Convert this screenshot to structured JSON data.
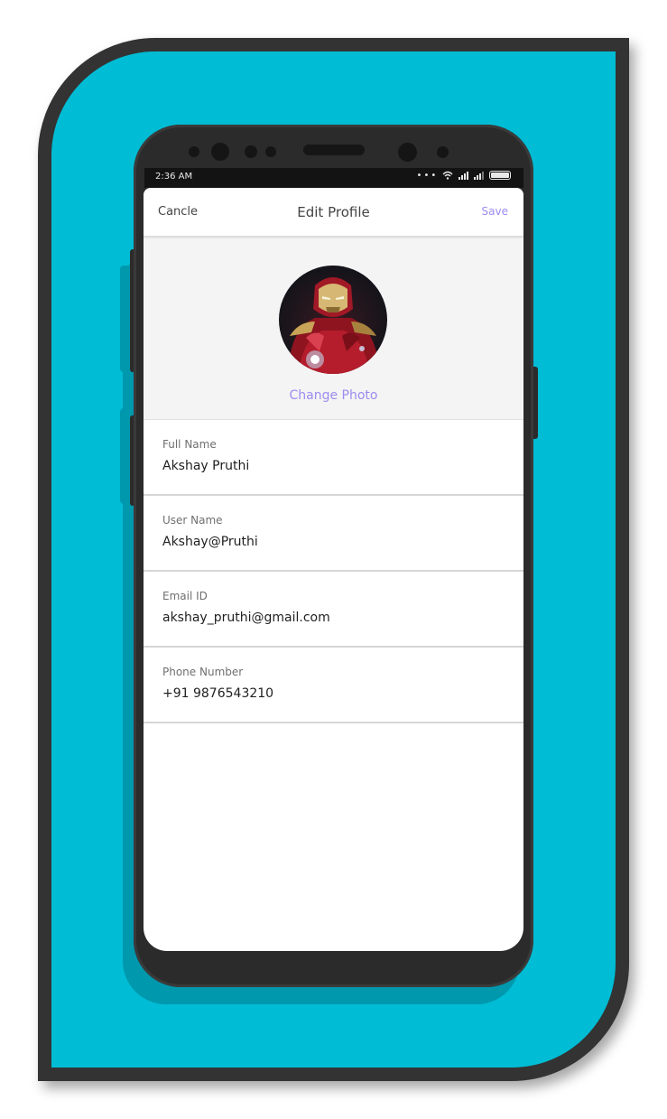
{
  "status_bar": {
    "time": "2:36 AM",
    "icons": [
      "more-icon",
      "wifi-icon",
      "signal-icon",
      "signal-icon",
      "battery-icon"
    ]
  },
  "header": {
    "cancel_label": "Cancle",
    "title": "Edit Profile",
    "save_label": "Save"
  },
  "profile_photo": {
    "change_label": "Change Photo"
  },
  "fields": [
    {
      "label": "Full Name",
      "value": "Akshay Pruthi"
    },
    {
      "label": "User Name",
      "value": "Akshay@Pruthi"
    },
    {
      "label": "Email ID",
      "value": "akshay_pruthi@gmail.com"
    },
    {
      "label": "Phone Number",
      "value": "+91 9876543210"
    }
  ],
  "colors": {
    "accent": "#9B8CF0",
    "background": "#00BCD4",
    "frame": "#333333",
    "phone_body": "#2B2B2B"
  }
}
